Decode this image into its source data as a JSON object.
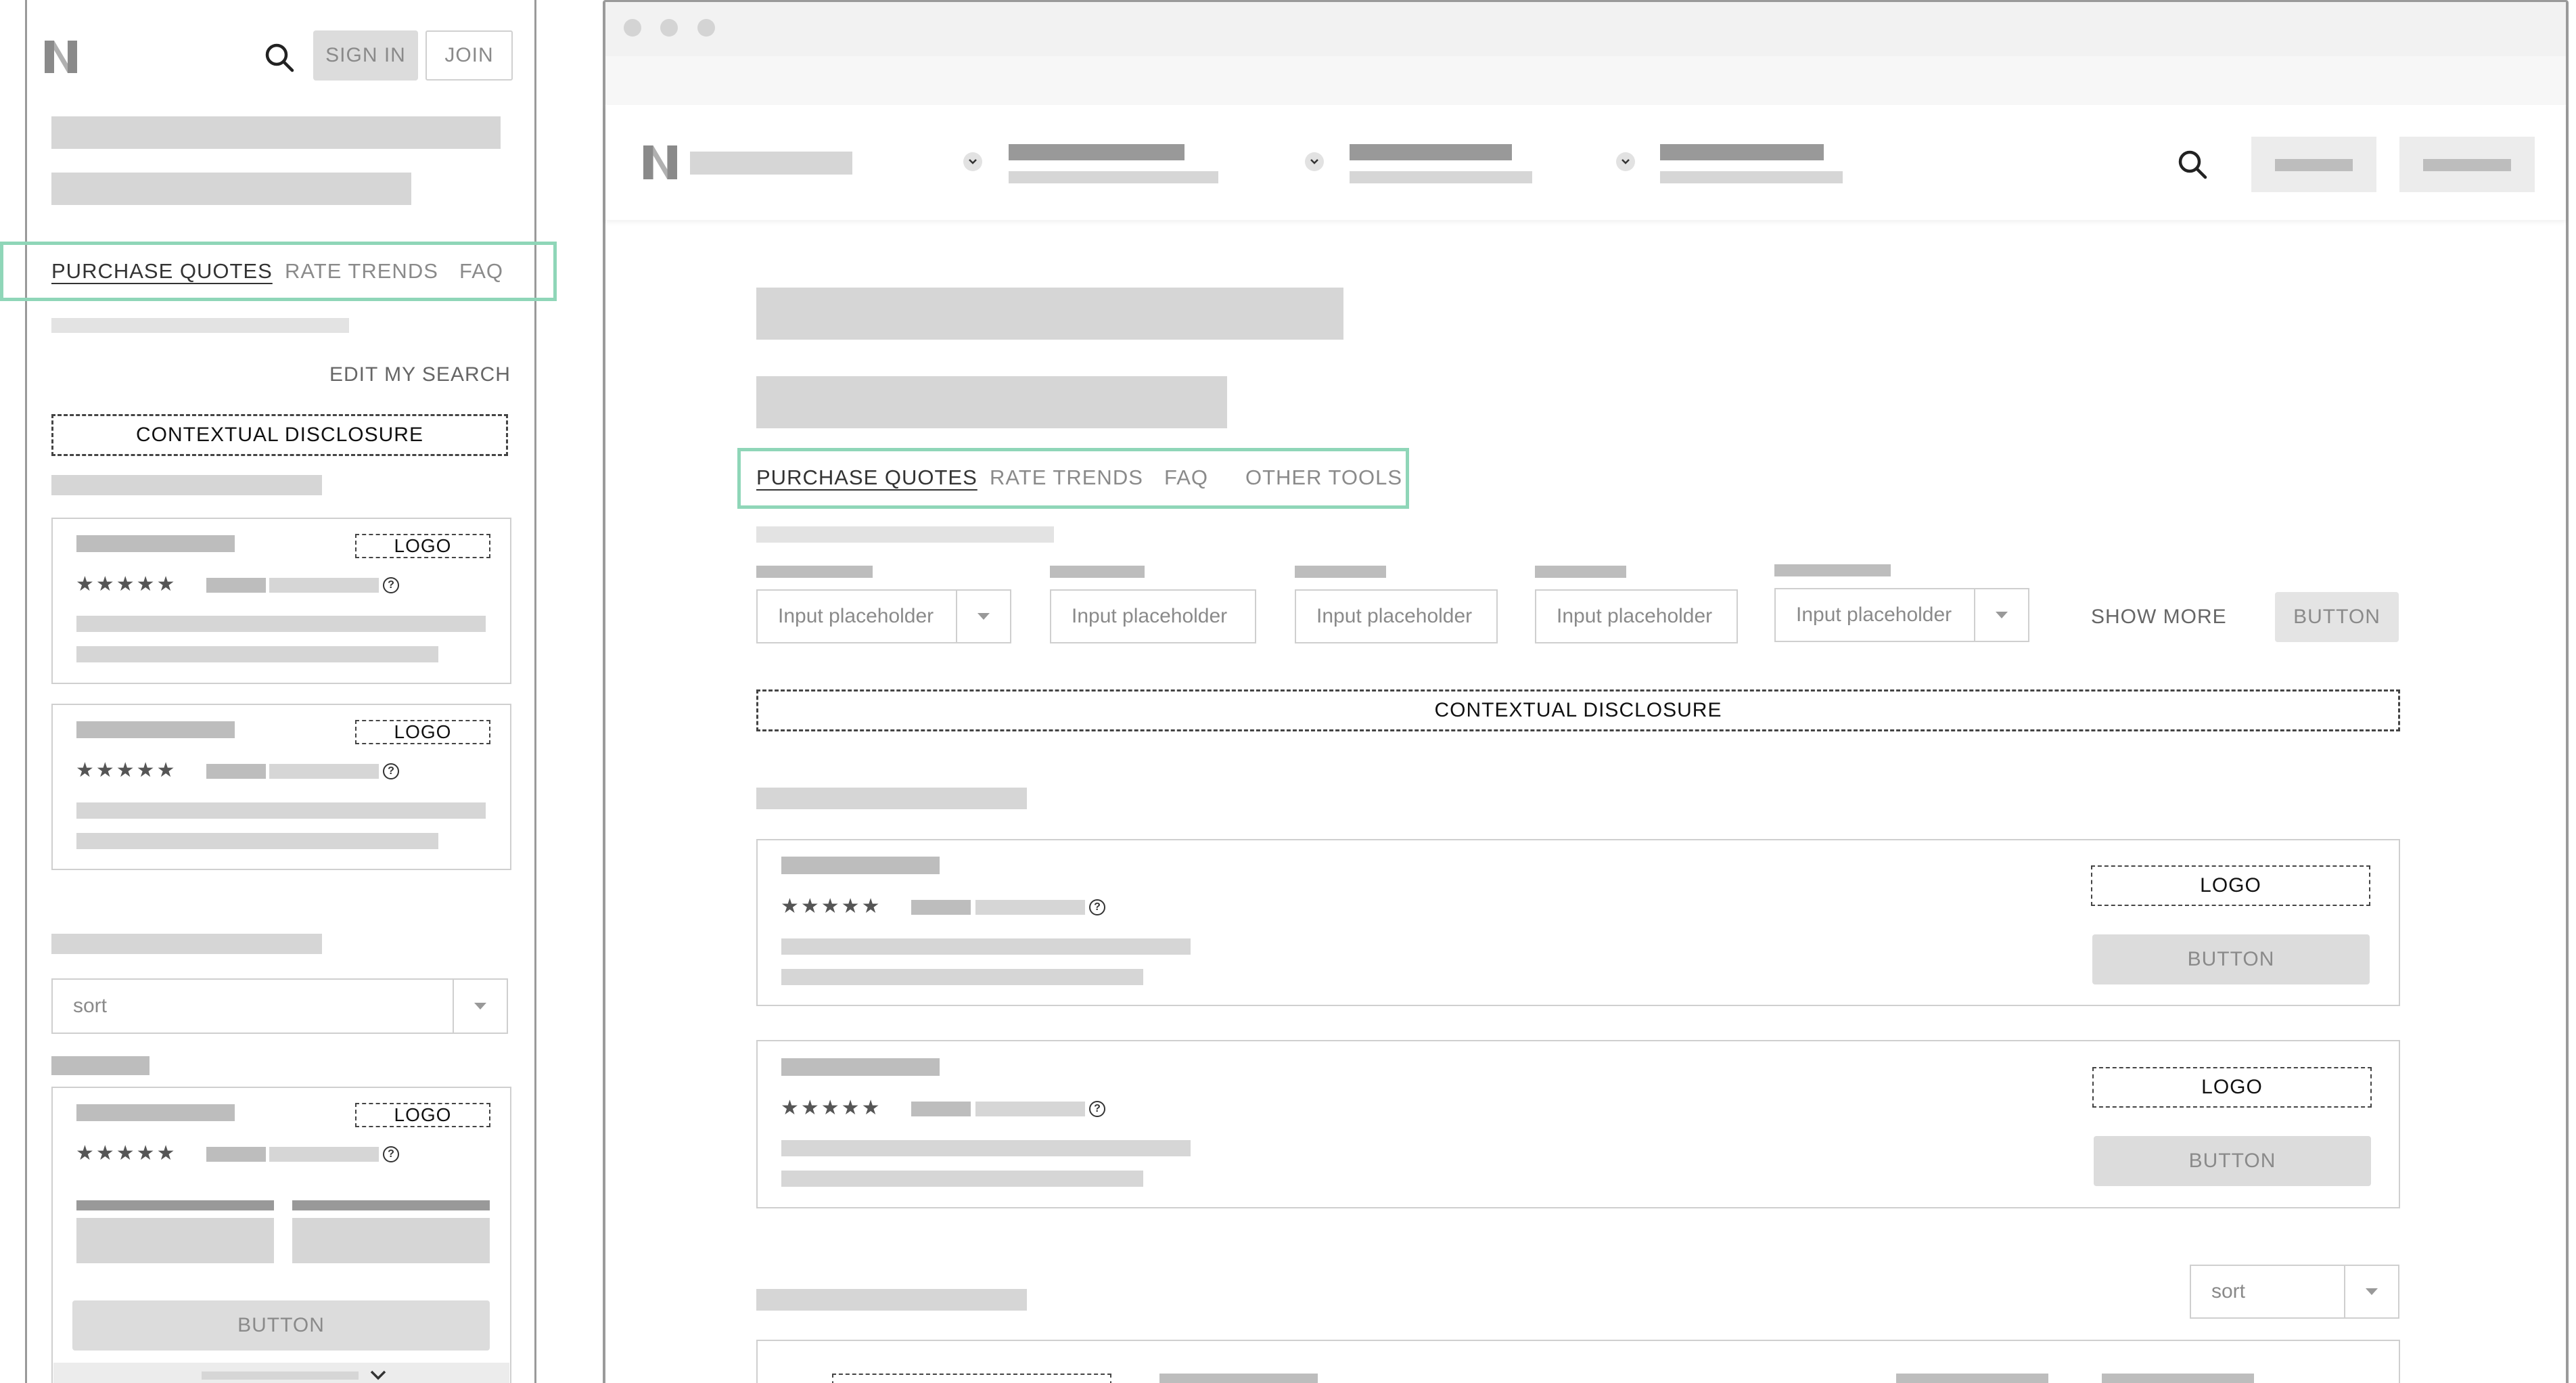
{
  "mobile": {
    "header": {
      "sign_in": "SIGN IN",
      "join": "JOIN"
    },
    "tabs": [
      {
        "label": "PURCHASE QUOTES",
        "active": true
      },
      {
        "label": "RATE TRENDS",
        "active": false
      },
      {
        "label": "FAQ",
        "active": false
      }
    ],
    "edit_search": "EDIT MY SEARCH",
    "disclosure": "CONTEXTUAL DISCLOSURE",
    "cards": [
      {
        "logo": "LOGO",
        "stars": "★★★★★"
      },
      {
        "logo": "LOGO",
        "stars": "★★★★★"
      }
    ],
    "sort": {
      "value": "sort"
    },
    "expanded_card": {
      "logo": "LOGO",
      "stars": "★★★★★",
      "button": "BUTTON"
    }
  },
  "desktop": {
    "header": {},
    "tabs": [
      {
        "label": "PURCHASE QUOTES",
        "active": true
      },
      {
        "label": "RATE TRENDS",
        "active": false
      },
      {
        "label": "FAQ",
        "active": false
      },
      {
        "label": "OTHER TOOLS",
        "active": false
      }
    ],
    "filters": [
      {
        "placeholder": "Input placeholder",
        "dropdown": true
      },
      {
        "placeholder": "Input placeholder",
        "dropdown": false
      },
      {
        "placeholder": "Input placeholder",
        "dropdown": false
      },
      {
        "placeholder": "Input placeholder",
        "dropdown": false
      },
      {
        "placeholder": "Input placeholder",
        "dropdown": true
      }
    ],
    "show_more": "SHOW MORE",
    "filter_button": "BUTTON",
    "disclosure": "CONTEXTUAL DISCLOSURE",
    "cards": [
      {
        "logo": "LOGO",
        "stars": "★★★★★",
        "button": "BUTTON"
      },
      {
        "logo": "LOGO",
        "stars": "★★★★★",
        "button": "BUTTON"
      }
    ],
    "sort": {
      "value": "sort"
    }
  },
  "colors": {
    "highlight": "#8fd6b8",
    "placeholder": "#d6d6d6",
    "border": "#cfcfcf"
  }
}
